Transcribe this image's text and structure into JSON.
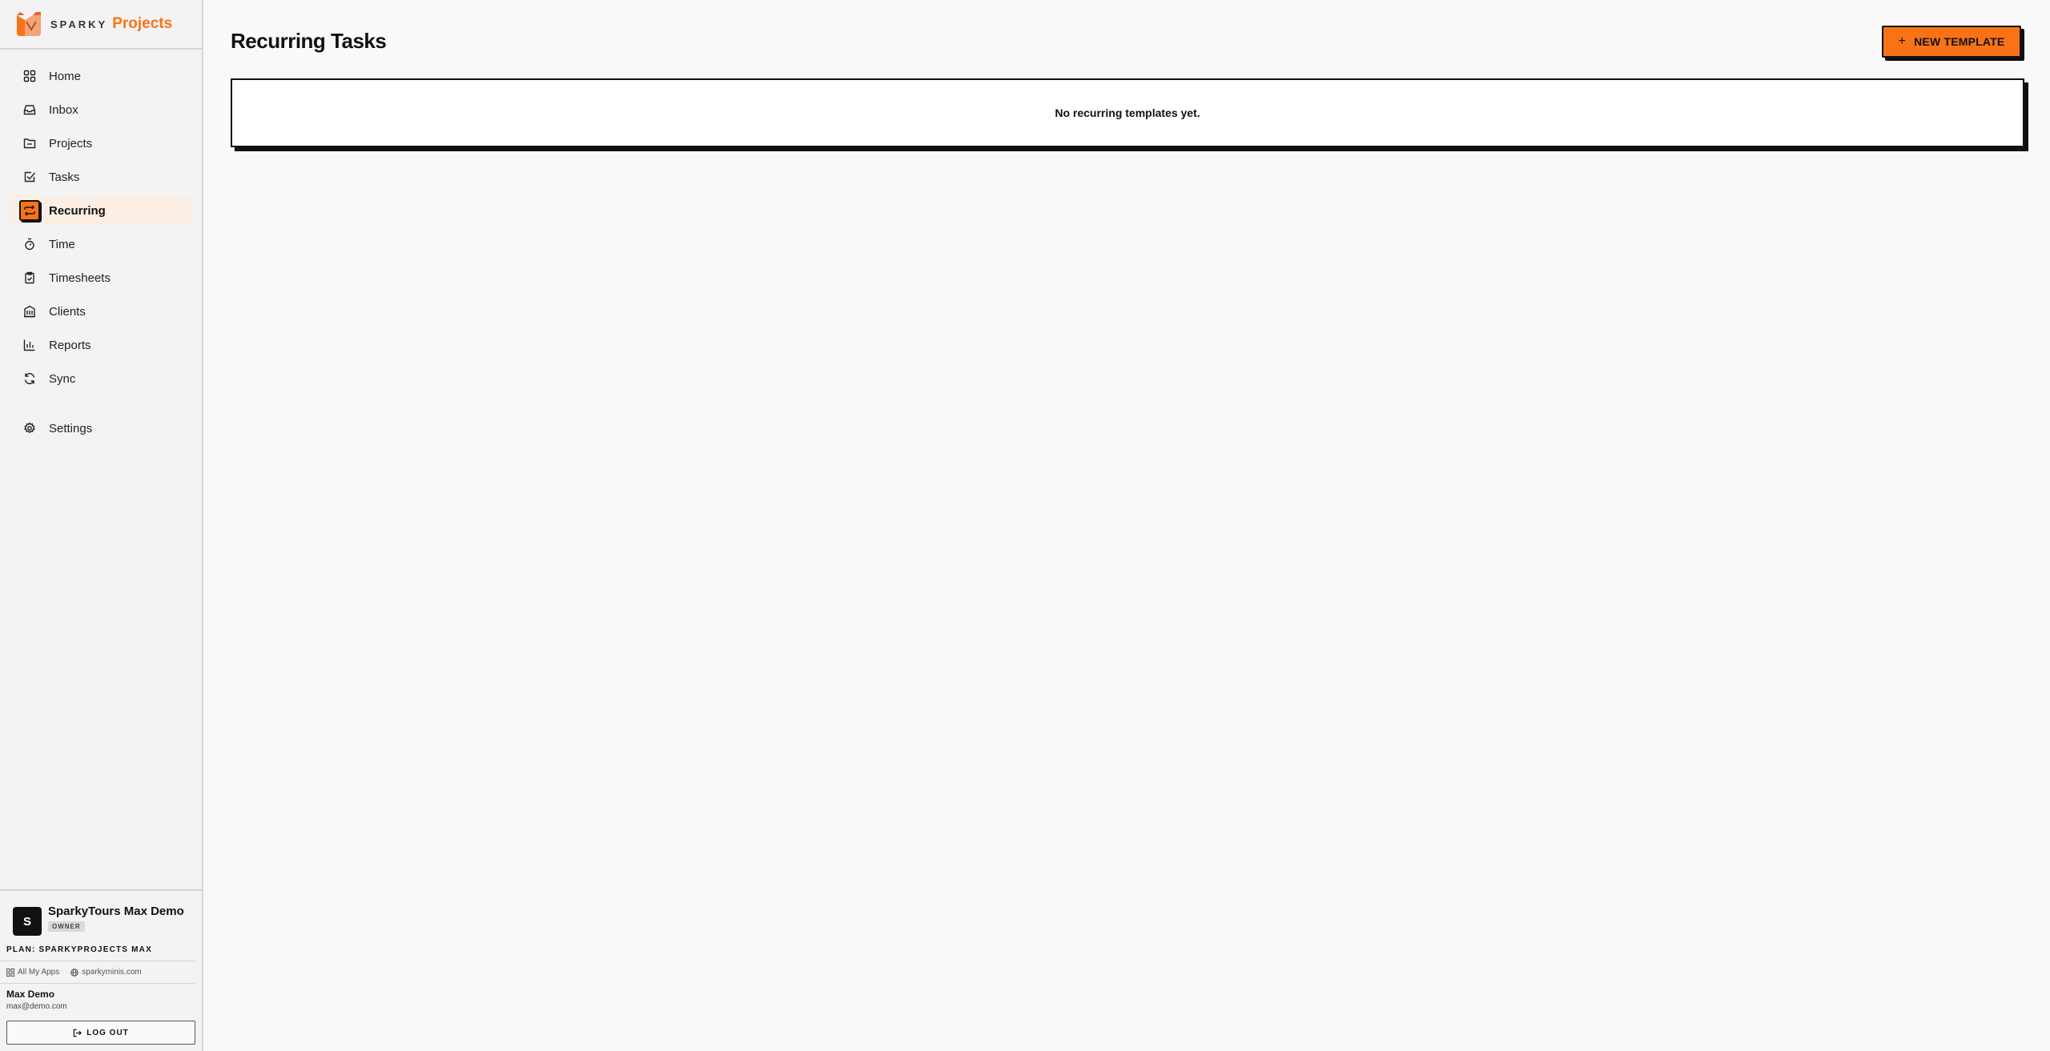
{
  "brand": {
    "sparky": "SPARKY",
    "product": "Projects"
  },
  "nav": [
    {
      "label": "Home",
      "icon": "home-icon"
    },
    {
      "label": "Inbox",
      "icon": "inbox-icon"
    },
    {
      "label": "Projects",
      "icon": "folder-icon"
    },
    {
      "label": "Tasks",
      "icon": "checkbox-icon"
    },
    {
      "label": "Recurring",
      "icon": "repeat-icon",
      "active": true
    },
    {
      "label": "Time",
      "icon": "stopwatch-icon"
    },
    {
      "label": "Timesheets",
      "icon": "clipboard-check-icon"
    },
    {
      "label": "Clients",
      "icon": "building-icon"
    },
    {
      "label": "Reports",
      "icon": "bar-chart-icon"
    },
    {
      "label": "Sync",
      "icon": "refresh-icon"
    }
  ],
  "settings": {
    "label": "Settings",
    "icon": "gear-icon"
  },
  "org": {
    "initial": "S",
    "name": "SparkyTours Max Demo",
    "role": "OWNER"
  },
  "plan": "PLAN: SPARKYPROJECTS MAX",
  "links": {
    "apps": "All My Apps",
    "site": "sparkyminis.com"
  },
  "user": {
    "name": "Max Demo",
    "email": "max@demo.com"
  },
  "logout": "LOG OUT",
  "page": {
    "title": "Recurring Tasks",
    "new_button": "NEW TEMPLATE",
    "new_button_icon": "+",
    "empty_message": "No recurring templates yet."
  },
  "colors": {
    "accent": "#f97316",
    "active_bg": "#fbeee4",
    "border": "#111111"
  }
}
